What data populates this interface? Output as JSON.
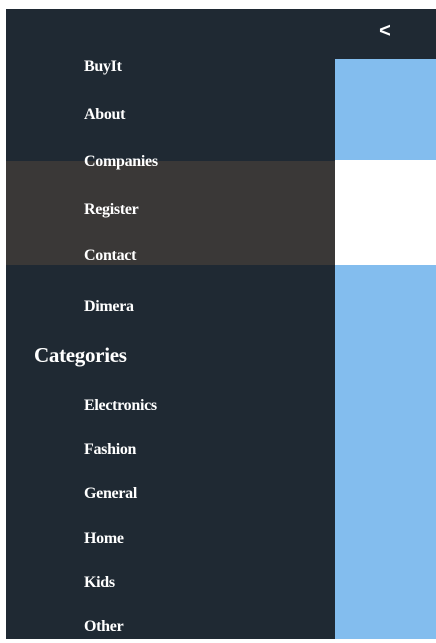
{
  "header": {
    "back_label": "<"
  },
  "sidebar": {
    "nav_items": [
      {
        "label": "BuyIt"
      },
      {
        "label": "About"
      },
      {
        "label": "Companies"
      },
      {
        "label": "Register"
      },
      {
        "label": "Contact"
      },
      {
        "label": "Dimera"
      }
    ],
    "categories_heading": "Categories",
    "categories": [
      {
        "label": "Electronics"
      },
      {
        "label": "Fashion"
      },
      {
        "label": "General"
      },
      {
        "label": "Home"
      },
      {
        "label": "Kids"
      },
      {
        "label": "Other"
      }
    ]
  },
  "colors": {
    "sidebar_bg": "#1f2933",
    "overlay": "#3a3837",
    "accent_blue": "#83bdee",
    "text": "#ffffff"
  }
}
